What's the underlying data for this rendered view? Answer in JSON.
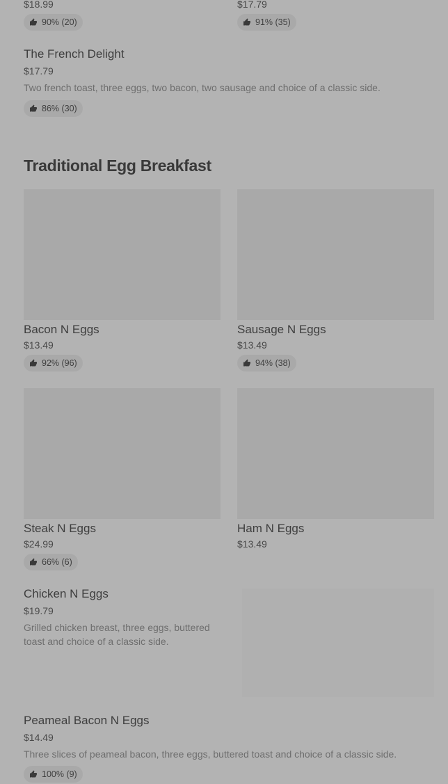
{
  "top_items": [
    {
      "price": "$18.99",
      "rating": "90% (20)"
    },
    {
      "price": "$17.79",
      "rating": "91% (35)"
    }
  ],
  "french_delight": {
    "name": "The French Delight",
    "price": "$17.79",
    "description": "Two french toast, three eggs, two bacon, two sausage and choice of a classic side.",
    "rating": "86% (30)"
  },
  "section": {
    "title": "Traditional Egg Breakfast"
  },
  "items": [
    {
      "name": "Bacon N Eggs",
      "price": "$13.49",
      "rating": "92% (96)"
    },
    {
      "name": "Sausage N Eggs",
      "price": "$13.49",
      "rating": "94% (38)"
    },
    {
      "name": "Steak N Eggs",
      "price": "$24.99",
      "rating": "66% (6)"
    },
    {
      "name": "Ham N Eggs",
      "price": "$13.49"
    }
  ],
  "chicken": {
    "name": "Chicken N Eggs",
    "price": "$19.79",
    "description_line1": "Grilled chicken breast, three eggs, buttered",
    "description_line2": "toast and choice of a classic side."
  },
  "peameal": {
    "name": "Peameal Bacon N Eggs",
    "price": "$14.49",
    "description": "Three slices of peameal bacon, three eggs, buttered toast and choice of a classic side.",
    "rating": "100% (9)"
  },
  "icons": {
    "rating": "thumbs-up-icon"
  }
}
